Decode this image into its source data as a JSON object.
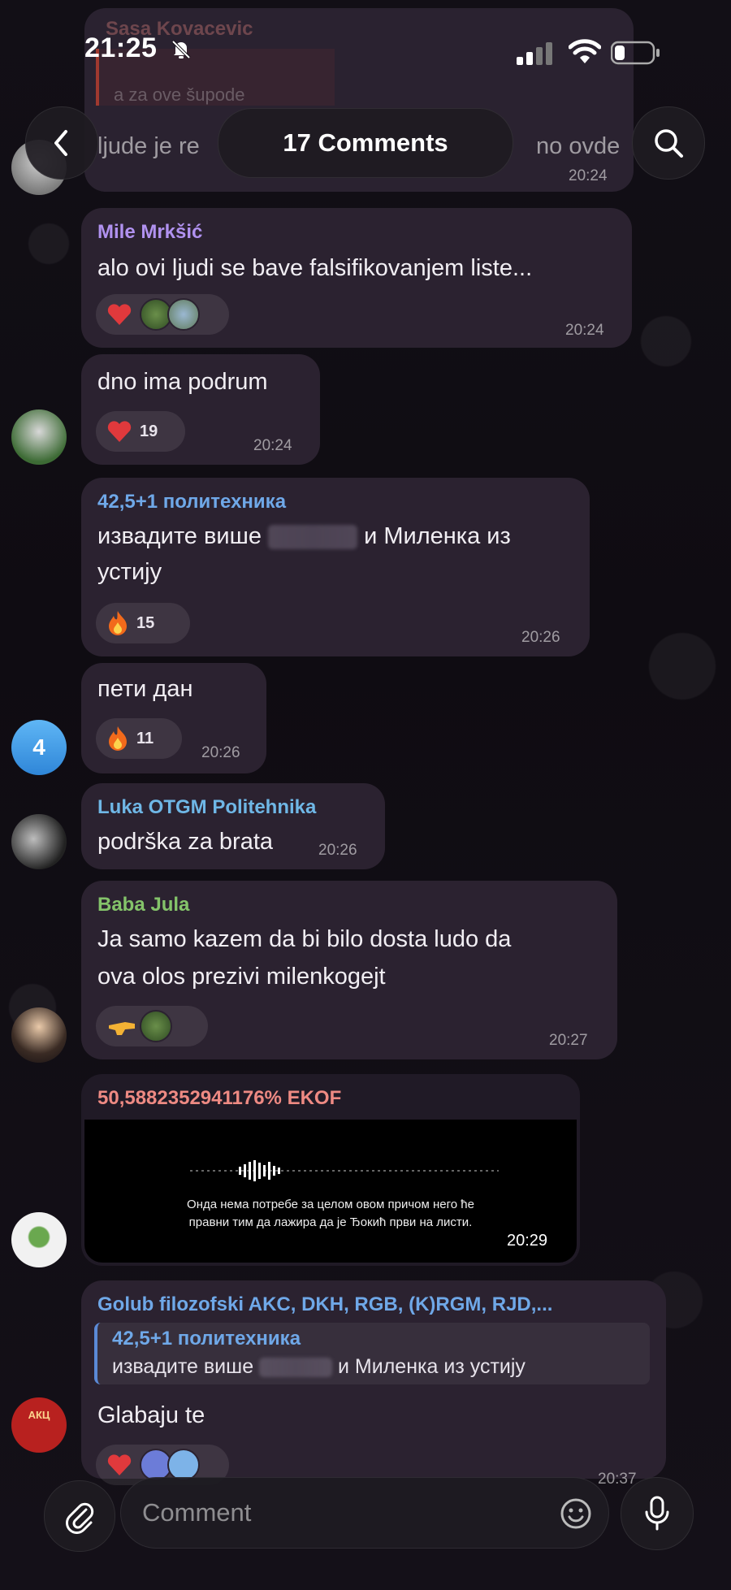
{
  "status_bar": {
    "time": "21:25"
  },
  "header": {
    "title": "17 Comments",
    "back_icon": "chevron-left-icon",
    "search_icon": "search-icon"
  },
  "top_partial": {
    "name": "Sasa Kovacevic",
    "quote": "a za ove šupode",
    "text": "ljude je re",
    "text_tail": "no ovde",
    "time": "20:24"
  },
  "messages": [
    {
      "name": "Mile Mrkšić",
      "name_color": "#b192f0",
      "text": "alo ovi ljudi se bave falsifikovanjem liste...",
      "time": "20:24"
    },
    {
      "text": "dno ima podrum",
      "reaction_count": "19",
      "time": "20:24"
    },
    {
      "name": "42,5+1 политехника",
      "name_color": "#6fa8e8",
      "text_before": "извадите више",
      "text_after": "и Миленка из",
      "text_line2": "устију",
      "reaction_count": "15",
      "time": "20:26"
    },
    {
      "text": "пети дан",
      "reaction_count": "11",
      "time": "20:26",
      "avatar_label": "4"
    },
    {
      "name": "Luka OTGM Politehnika",
      "name_color": "#6fb7e6",
      "text": "podrška za brata",
      "time": "20:26"
    },
    {
      "name": "Baba Jula",
      "name_color": "#84c36a",
      "text_line1": "Ja samo kazem da bi bilo dosta ludo da",
      "text_line2": "ova olos prezivi milenkogejt",
      "time": "20:27"
    },
    {
      "name": "50,5882352941176% EKOF",
      "name_color": "#ee8a83",
      "caption_line1": "Онда нема потребе за целом овом причом него ће",
      "caption_line2": "правни тим да лажира да је Ђокић први на листи.",
      "time": "20:29"
    },
    {
      "name": "Golub filozofski AKC, DKH, RGB, (K)RGM, RJD,...",
      "name_color": "#6fa8e8",
      "reply_name": "42,5+1 политехника",
      "reply_before": "извадите више",
      "reply_after": "и Миленка из устију",
      "text": "Glabaju te",
      "time": "20:37",
      "avatar_label": "АКЦ"
    }
  ],
  "input": {
    "placeholder": "Comment",
    "attach_icon": "paperclip-icon",
    "emoji_icon": "emoji-icon",
    "mic_icon": "microphone-icon"
  },
  "colors": {
    "bubble": "#2b2230",
    "accent": "#6fa8e8"
  }
}
